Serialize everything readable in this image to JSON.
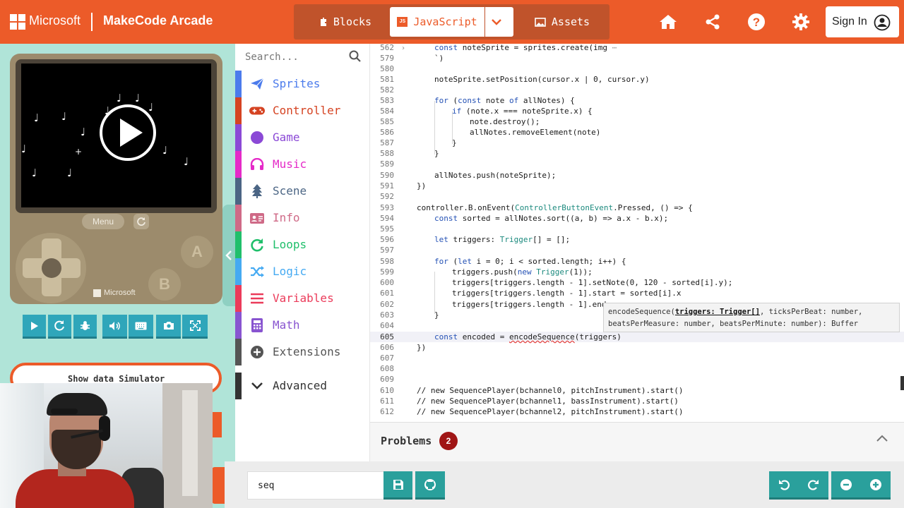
{
  "header": {
    "brand": "Microsoft",
    "app_title": "MakeCode Arcade",
    "tabs": {
      "blocks": "Blocks",
      "javascript": "JavaScript",
      "assets": "Assets"
    },
    "sign_in": "Sign In",
    "accent": "#ec5b29"
  },
  "simulator": {
    "menu_label": "Menu",
    "btn_a": "A",
    "btn_b": "B",
    "brand": "Microsoft",
    "show_data_label": "Show data Simulator",
    "toolbar_icons": [
      "play-icon",
      "restart-icon",
      "debug-icon",
      "volume-icon",
      "keyboard-icon",
      "screenshot-icon",
      "fullscreen-icon"
    ]
  },
  "toolbox": {
    "search_placeholder": "Search...",
    "items": [
      {
        "label": "Sprites",
        "color": "#4b7bec",
        "icon": "paper-plane-icon"
      },
      {
        "label": "Controller",
        "color": "#d54322",
        "icon": "gamepad-icon"
      },
      {
        "label": "Game",
        "color": "#8b49d6",
        "icon": "circle-icon"
      },
      {
        "label": "Music",
        "color": "#e52ac8",
        "icon": "headphones-icon"
      },
      {
        "label": "Scene",
        "color": "#4b6584",
        "icon": "tree-icon"
      },
      {
        "label": "Info",
        "color": "#cf6a87",
        "icon": "id-card-icon"
      },
      {
        "label": "Loops",
        "color": "#20bf6b",
        "icon": "loop-icon"
      },
      {
        "label": "Logic",
        "color": "#45aaf2",
        "icon": "shuffle-icon"
      },
      {
        "label": "Variables",
        "color": "#eb3b5a",
        "icon": "list-icon"
      },
      {
        "label": "Math",
        "color": "#8854d0",
        "icon": "calculator-icon"
      },
      {
        "label": "Extensions",
        "color": "#555555",
        "icon": "plus-circle-icon"
      },
      {
        "label": "Advanced",
        "color": "#333333",
        "icon": "chevron-down-icon"
      }
    ]
  },
  "editor": {
    "lines": [
      {
        "n": "562",
        "t": "const noteSprite = sprites.create(img ⋯"
      },
      {
        "n": "579",
        "t": "`)"
      },
      {
        "n": "580",
        "t": ""
      },
      {
        "n": "581",
        "t": "noteSprite.setPosition(cursor.x | 0, cursor.y)"
      },
      {
        "n": "582",
        "t": ""
      },
      {
        "n": "583",
        "t": "for (const note of allNotes) {"
      },
      {
        "n": "584",
        "t": "if (note.x === noteSprite.x) {"
      },
      {
        "n": "585",
        "t": "note.destroy();"
      },
      {
        "n": "586",
        "t": "allNotes.removeElement(note)"
      },
      {
        "n": "587",
        "t": "}"
      },
      {
        "n": "588",
        "t": "}"
      },
      {
        "n": "589",
        "t": ""
      },
      {
        "n": "590",
        "t": "allNotes.push(noteSprite);"
      },
      {
        "n": "591",
        "t": "})"
      },
      {
        "n": "592",
        "t": ""
      },
      {
        "n": "593",
        "t": "controller.B.onEvent(ControllerButtonEvent.Pressed, () => {"
      },
      {
        "n": "594",
        "t": "const sorted = allNotes.sort((a, b) => a.x - b.x);"
      },
      {
        "n": "595",
        "t": ""
      },
      {
        "n": "596",
        "t": "let triggers: Trigger[] = [];"
      },
      {
        "n": "597",
        "t": ""
      },
      {
        "n": "598",
        "t": "for (let i = 0; i < sorted.length; i++) {"
      },
      {
        "n": "599",
        "t": "triggers.push(new Trigger(1));"
      },
      {
        "n": "600",
        "t": "triggers[triggers.length - 1].setNote(0, 120 - sorted[i].y);"
      },
      {
        "n": "601",
        "t": "triggers[triggers.length - 1].start = sorted[i].x"
      },
      {
        "n": "602",
        "t": "triggers[triggers.length - 1].end"
      },
      {
        "n": "603",
        "t": "}"
      },
      {
        "n": "604",
        "t": ""
      },
      {
        "n": "605",
        "t": "const encoded = encodeSequence(triggers)"
      },
      {
        "n": "606",
        "t": "})"
      },
      {
        "n": "607",
        "t": ""
      },
      {
        "n": "608",
        "t": ""
      },
      {
        "n": "609",
        "t": ""
      },
      {
        "n": "610",
        "t": "// new SequencePlayer(bchannel0, pitchInstrument).start()"
      },
      {
        "n": "611",
        "t": "// new SequencePlayer(bchannel1, bassInstrument).start()"
      },
      {
        "n": "612",
        "t": "// new SequencePlayer(bchannel2, pitchInstrument).start()"
      }
    ],
    "param_hint": {
      "fn": "encodeSequence(",
      "active_param": "triggers: Trigger[]",
      "rest_line1": ", ticksPerBeat: number,",
      "line2": "beatsPerMeasure: number, beatsPerMinute: number): Buffer"
    }
  },
  "problems": {
    "title": "Problems",
    "count": "2"
  },
  "bottom": {
    "project_name": "seq"
  }
}
